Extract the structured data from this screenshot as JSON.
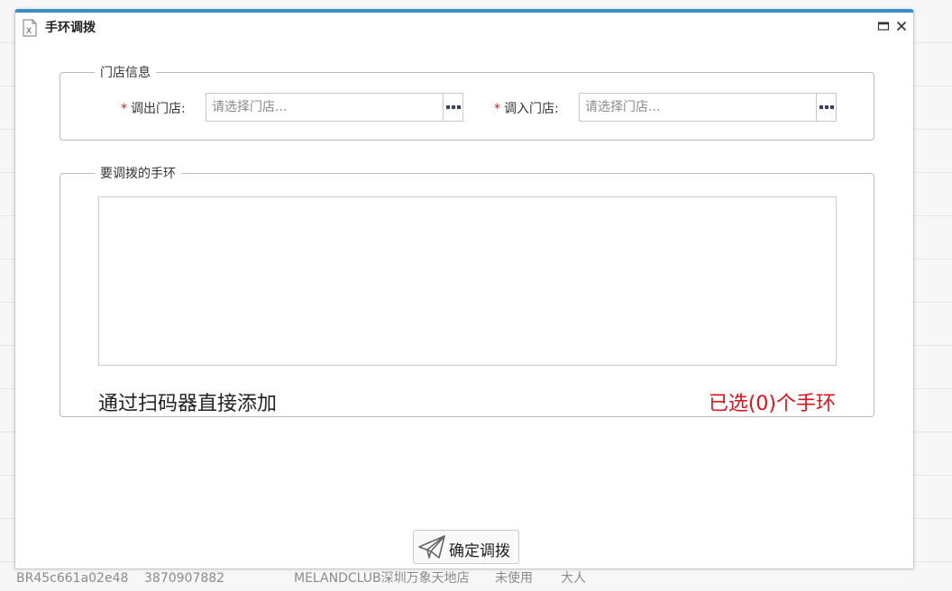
{
  "dialog": {
    "title": "手环调拨",
    "icon": "excel-file-icon",
    "maximize_icon": "maximize-icon",
    "close_icon": "close-icon"
  },
  "store_info": {
    "legend": "门店信息",
    "required_mark": "*",
    "from_label": "调出门店:",
    "from_placeholder": "请选择门店...",
    "to_label": "调入门店:",
    "to_placeholder": "请选择门店..."
  },
  "bands": {
    "legend": "要调拨的手环",
    "scan_hint": "通过扫码器直接添加",
    "selected_count": "已选(0)个手环"
  },
  "confirm_button": {
    "label": "确定调拨",
    "icon": "paper-plane-icon"
  },
  "background_row": {
    "id": "BR45c661a02e48",
    "number": "3870907882",
    "store": "MELANDCLUB深圳万象天地店",
    "status": "未使用",
    "type": "大人"
  },
  "colors": {
    "accent": "#3b8ec5",
    "required": "#d9181e",
    "count_text": "#e3101b"
  }
}
